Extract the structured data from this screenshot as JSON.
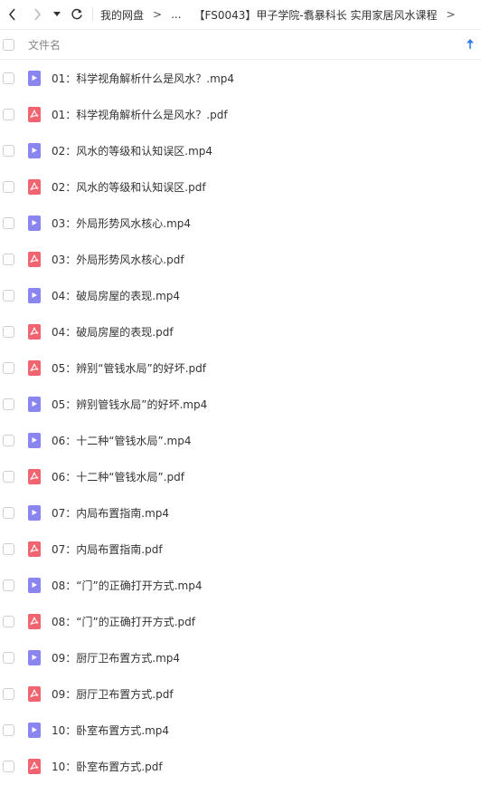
{
  "toolbar": {
    "breadcrumb": {
      "root": "我的网盘",
      "sep1": ">",
      "ellipsis": "...",
      "current": "【FS0043】甲子学院-翥暴科长 实用家居风水课程",
      "sep2": ">"
    }
  },
  "header": {
    "column_name": "文件名"
  },
  "files": [
    {
      "name": "01：科学视角解析什么是风水？.mp4",
      "type": "video"
    },
    {
      "name": "01：科学视角解析什么是风水？.pdf",
      "type": "pdf"
    },
    {
      "name": "02：风水的等级和认知误区.mp4",
      "type": "video"
    },
    {
      "name": "02：风水的等级和认知误区.pdf",
      "type": "pdf"
    },
    {
      "name": "03：外局形势风水核心.mp4",
      "type": "video"
    },
    {
      "name": "03：外局形势风水核心.pdf",
      "type": "pdf"
    },
    {
      "name": "04：破局房屋的表现.mp4",
      "type": "video"
    },
    {
      "name": "04：破局房屋的表现.pdf",
      "type": "pdf"
    },
    {
      "name": "05：辨别“管钱水局”的好坏.pdf",
      "type": "pdf"
    },
    {
      "name": "05：辨别管钱水局”的好坏.mp4",
      "type": "video"
    },
    {
      "name": "06：十二种“管钱水局”.mp4",
      "type": "video"
    },
    {
      "name": "06：十二种“管钱水局”.pdf",
      "type": "pdf"
    },
    {
      "name": "07：内局布置指南.mp4",
      "type": "video"
    },
    {
      "name": "07：内局布置指南.pdf",
      "type": "pdf"
    },
    {
      "name": "08：“门”的正确打开方式.mp4",
      "type": "video"
    },
    {
      "name": "08：“门”的正确打开方式.pdf",
      "type": "pdf"
    },
    {
      "name": "09：厨厅卫布置方式.mp4",
      "type": "video"
    },
    {
      "name": "09：厨厅卫布置方式.pdf",
      "type": "pdf"
    },
    {
      "name": "10：卧室布置方式.mp4",
      "type": "video"
    },
    {
      "name": "10：卧室布置方式.pdf",
      "type": "pdf"
    }
  ],
  "icons": {
    "video": "play-file-icon",
    "pdf": "pdf-file-icon"
  },
  "colors": {
    "video_icon": "#8b85f1",
    "pdf_icon": "#f06470",
    "sort_arrow": "#2f7cf6"
  }
}
